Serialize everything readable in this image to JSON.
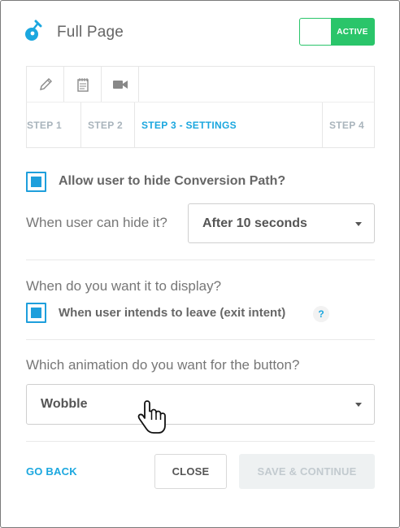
{
  "header": {
    "title": "Full Page",
    "logo_icon": "guitar-pick-logo-icon",
    "toggle": {
      "label": "ACTIVE",
      "state": "on",
      "color": "#2ac56a"
    }
  },
  "toolbar": {
    "tools": [
      {
        "name": "pencil-icon"
      },
      {
        "name": "notepad-icon"
      },
      {
        "name": "video-camera-icon"
      }
    ]
  },
  "steps": {
    "items": [
      {
        "label": "STEP 1",
        "active": false
      },
      {
        "label": "STEP 2",
        "active": false
      },
      {
        "label": "STEP 3 - SETTINGS",
        "active": true
      },
      {
        "label": "STEP 4",
        "active": false
      }
    ],
    "active_color": "#1ba7df"
  },
  "settings": {
    "allow_hide": {
      "label": "Allow user to hide Conversion Path?",
      "checked": true
    },
    "hide_when": {
      "label": "When user can hide it?",
      "value": "After 10 seconds"
    },
    "display": {
      "question": "When do you want it to display?",
      "exit_intent": {
        "label": "When user intends to leave (exit intent)",
        "checked": true,
        "help": "?"
      }
    },
    "animation": {
      "question": "Which animation do you want for the button?",
      "value": "Wobble"
    }
  },
  "footer": {
    "go_back": "GO BACK",
    "close": "CLOSE",
    "save": "SAVE & CONTINUE",
    "save_enabled": false
  },
  "cursor": {
    "type": "hand-pointer"
  }
}
